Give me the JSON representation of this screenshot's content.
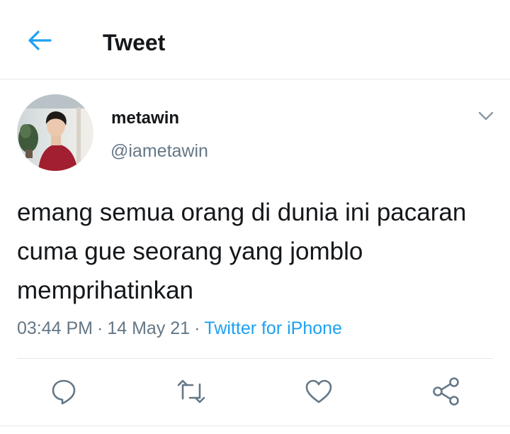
{
  "header": {
    "title": "Tweet",
    "back_icon": "arrow-left-icon"
  },
  "tweet": {
    "author": {
      "display_name": "metawin",
      "handle": "@iametawin"
    },
    "text": "emang semua orang di dunia ini pacaran cuma gue seorang yang jomblo memprihatinkan",
    "time": "03:44 PM",
    "date": "14 May 21",
    "source": "Twitter for iPhone",
    "separator": "·"
  },
  "actions": [
    {
      "name": "reply",
      "icon": "reply-icon"
    },
    {
      "name": "retweet",
      "icon": "retweet-icon"
    },
    {
      "name": "like",
      "icon": "heart-icon"
    },
    {
      "name": "share",
      "icon": "share-icon"
    }
  ],
  "colors": {
    "accent": "#1da1f2",
    "text_primary": "#14171a",
    "text_secondary": "#657786",
    "divider": "#e1e8ed"
  }
}
